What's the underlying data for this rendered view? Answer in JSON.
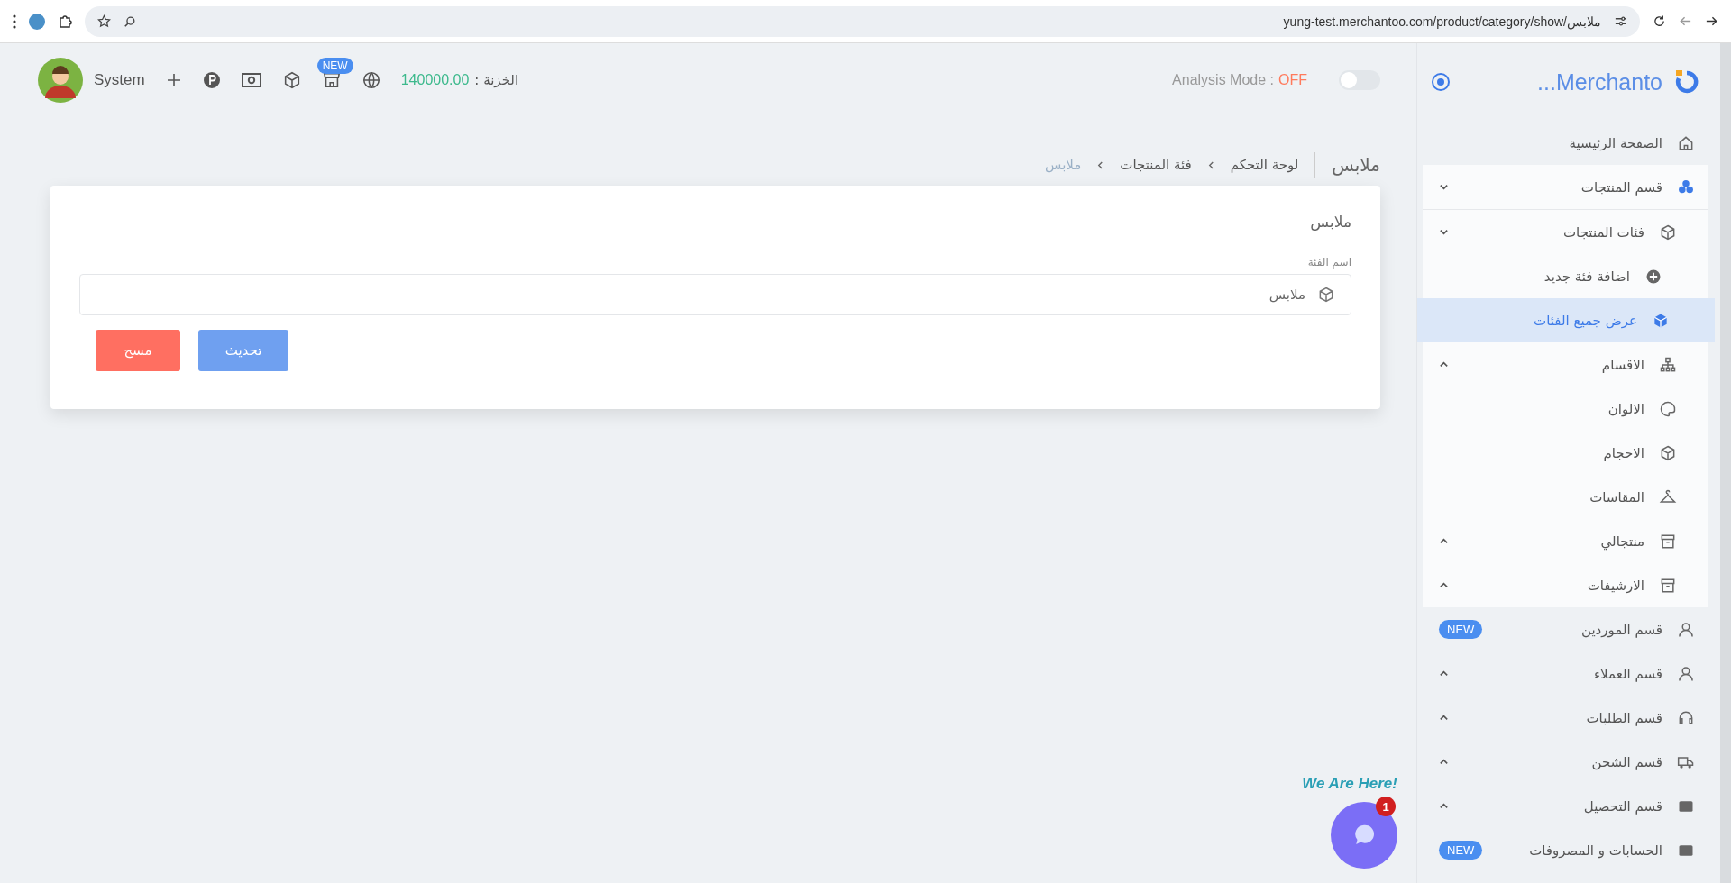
{
  "browser": {
    "url": "yung-test.merchantoo.com/product/category/show/ملابس"
  },
  "header": {
    "user": "System",
    "store_badge": "NEW",
    "treasury_label": "الخزنة :",
    "treasury_value": "140000.00",
    "analysis_label": "Analysis Mode :",
    "analysis_value": "OFF",
    "analysis_toggle": {
      "on": false
    }
  },
  "sidebar": {
    "brand": "Merchanto...",
    "items": [
      {
        "label": "الصفحة الرئيسية"
      },
      {
        "label": "قسم المنتجات",
        "expanded": true,
        "children": [
          {
            "label": "فئات المنتجات",
            "expanded": true,
            "children": [
              {
                "label": "اضافة فئة جديد",
                "selected": false
              },
              {
                "label": "عرض جميع الفئات",
                "selected": true
              }
            ]
          },
          {
            "label": "الاقسام",
            "expanded": false
          },
          {
            "label": "الالوان"
          },
          {
            "label": "الاحجام"
          },
          {
            "label": "المقاسات"
          },
          {
            "label": "منتجالي",
            "expanded": false
          },
          {
            "label": "الارشيفات",
            "expanded": false
          }
        ]
      },
      {
        "label": "قسم الموردين",
        "badge": "NEW"
      },
      {
        "label": "قسم العملاء",
        "expanded": false
      },
      {
        "label": "قسم الطلبات",
        "expanded": false
      },
      {
        "label": "قسم الشحن",
        "expanded": false
      },
      {
        "label": "قسم التحصيل",
        "expanded": false
      },
      {
        "label": "الحسابات و المصروفات",
        "badge": "NEW"
      }
    ]
  },
  "page": {
    "title": "ملابس",
    "breadcrumb": [
      {
        "label": "لوحة التحكم",
        "current": false
      },
      {
        "label": "فئة المنتجات",
        "current": false
      },
      {
        "label": "ملابس",
        "current": true
      }
    ]
  },
  "card": {
    "title": "ملابس",
    "field": {
      "label": "اسم الفئة",
      "value": "ملابس"
    },
    "buttons": [
      {
        "label": "تحديث",
        "kind": "primary"
      },
      {
        "label": "مسح",
        "kind": "danger"
      }
    ]
  },
  "chat": {
    "greeting": "We Are Here!",
    "unread": "1"
  }
}
